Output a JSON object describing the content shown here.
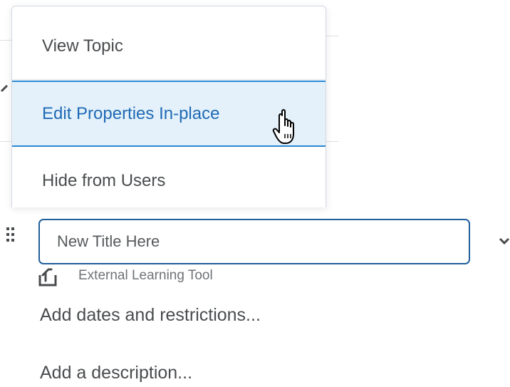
{
  "context_menu": {
    "items": [
      {
        "label": "View Topic",
        "state": "normal"
      },
      {
        "label": "Edit Properties In-place",
        "state": "hover"
      },
      {
        "label": "Hide from Users",
        "state": "normal"
      }
    ]
  },
  "topic_editor": {
    "title_input": {
      "value": "",
      "placeholder": "New Title Here"
    },
    "type": {
      "icon": "external-tool-icon",
      "label": "External Learning Tool"
    },
    "add_dates_link": "Add dates and restrictions...",
    "add_description_link": "Add a description..."
  },
  "colors": {
    "accent": "#2a88d4",
    "hover_bg": "#e4f1fb",
    "hover_text": "#1f6ab5",
    "input_border": "#1f5f9c",
    "text": "#494c4e"
  }
}
